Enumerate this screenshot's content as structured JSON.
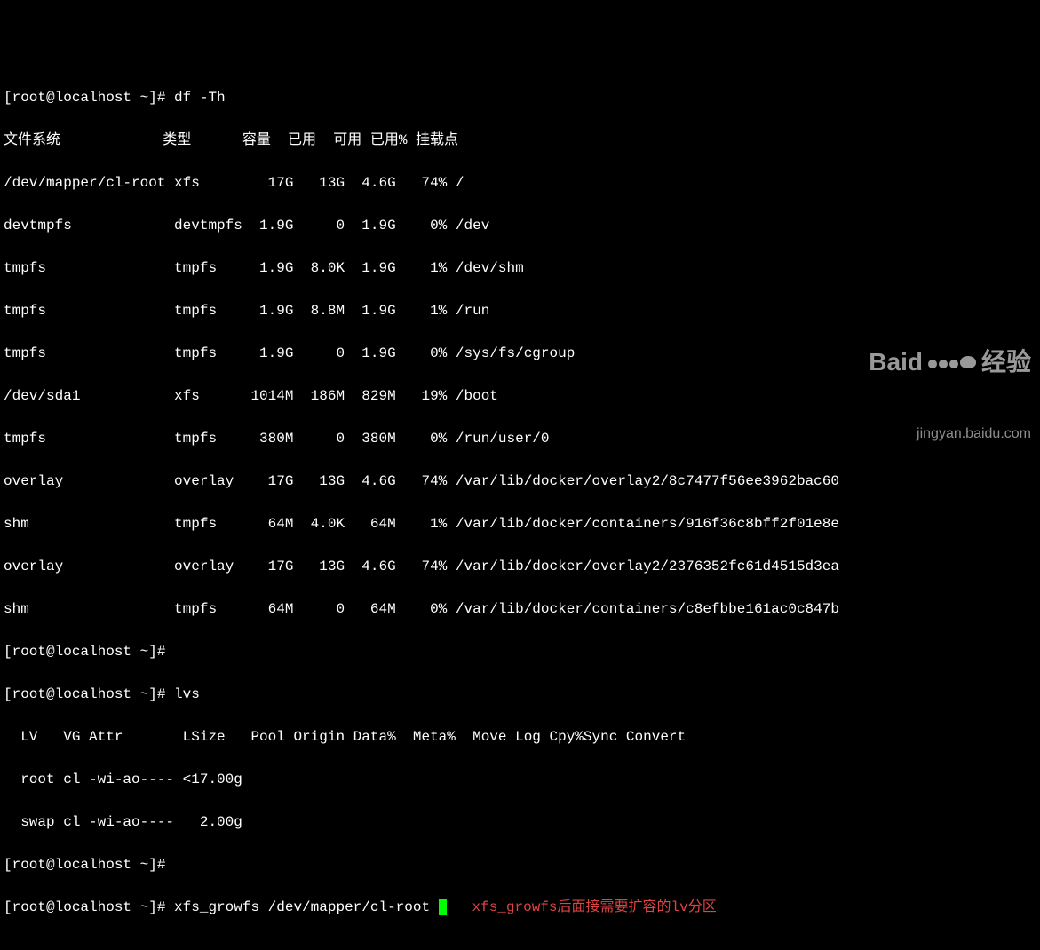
{
  "lines": {
    "l0": "[root@localhost ~]# df -Th",
    "l1": "文件系统            类型      容量  已用  可用 已用% 挂载点",
    "l2": "/dev/mapper/cl-root xfs        17G   13G  4.6G   74% /",
    "l3": "devtmpfs            devtmpfs  1.9G     0  1.9G    0% /dev",
    "l4": "tmpfs               tmpfs     1.9G  8.0K  1.9G    1% /dev/shm",
    "l5": "tmpfs               tmpfs     1.9G  8.8M  1.9G    1% /run",
    "l6": "tmpfs               tmpfs     1.9G     0  1.9G    0% /sys/fs/cgroup",
    "l7": "/dev/sda1           xfs      1014M  186M  829M   19% /boot",
    "l8": "tmpfs               tmpfs     380M     0  380M    0% /run/user/0",
    "l9": "overlay             overlay    17G   13G  4.6G   74% /var/lib/docker/overlay2/8c7477f56ee3962bac60",
    "l10": "shm                 tmpfs      64M  4.0K   64M    1% /var/lib/docker/containers/916f36c8bff2f01e8e",
    "l11": "overlay             overlay    17G   13G  4.6G   74% /var/lib/docker/overlay2/2376352fc61d4515d3ea",
    "l12": "shm                 tmpfs      64M     0   64M    0% /var/lib/docker/containers/c8efbbe161ac0c847b",
    "l13": "[root@localhost ~]# ",
    "l14": "[root@localhost ~]# lvs",
    "l15": "  LV   VG Attr       LSize   Pool Origin Data%  Meta%  Move Log Cpy%Sync Convert",
    "l16": "  root cl -wi-ao---- <17.00g                                                    ",
    "l17": "  swap cl -wi-ao----   2.00g                                                    ",
    "l18": "[root@localhost ~]# ",
    "l19": "[root@localhost ~]# xfs_growfs /dev/mapper/cl-root "
  },
  "annotation": "xfs_growfs后面接需要扩容的lv分区",
  "watermark": {
    "brand": "Baid",
    "brand2": "经验",
    "url": "jingyan.baidu.com"
  }
}
